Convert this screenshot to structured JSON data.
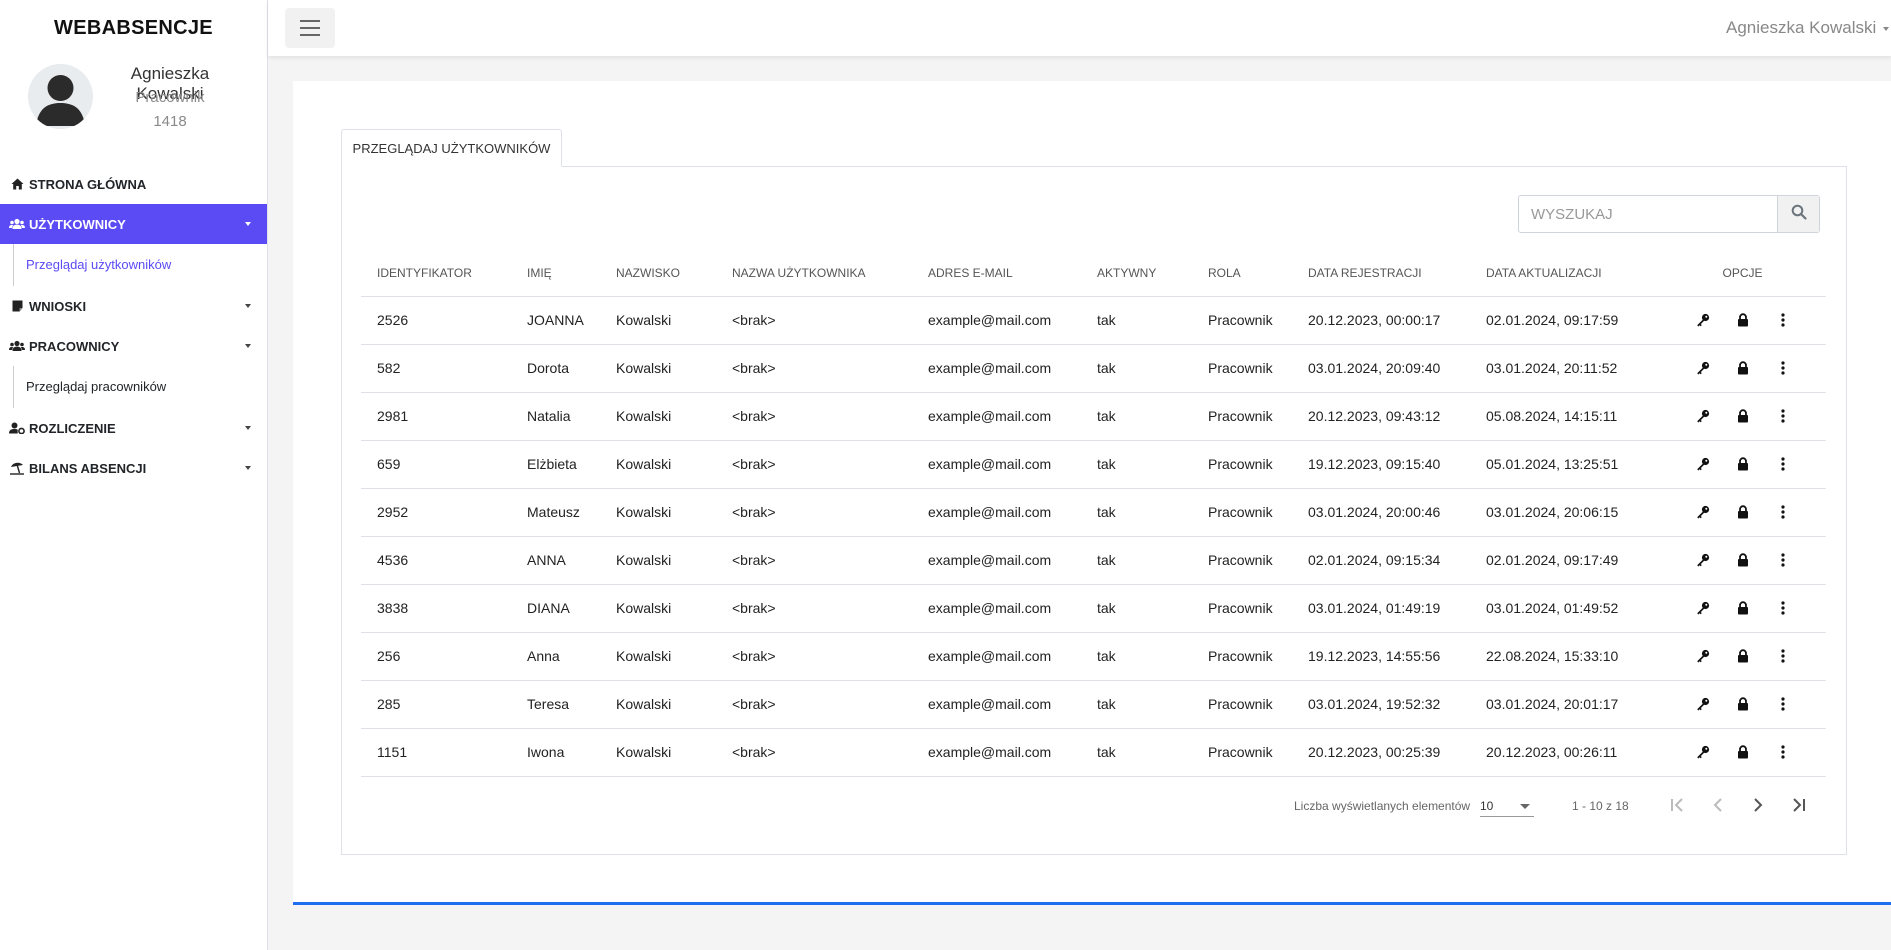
{
  "app": {
    "brand": "WEBABSENCJE"
  },
  "profile": {
    "name": "Agnieszka Kowalski",
    "role": "Pracownik",
    "id": "1418",
    "avatar_icon": "user-silhouette-icon"
  },
  "sidebar": {
    "items": [
      {
        "label": "STRONA GŁÓWNA",
        "icon": "home-icon"
      },
      {
        "label": "UŻYTKOWNICY",
        "icon": "users-icon",
        "active": true,
        "sub": "Przeglądaj użytkowników"
      },
      {
        "label": "WNIOSKI",
        "icon": "note-icon"
      },
      {
        "label": "PRACOWNICY",
        "icon": "users-icon",
        "sub": "Przeglądaj pracowników"
      },
      {
        "label": "ROZLICZENIE",
        "icon": "user-cog-icon"
      },
      {
        "label": "BILANS ABSENCJI",
        "icon": "umbrella-beach-icon"
      }
    ]
  },
  "topbar": {
    "user": "Agnieszka Kowalski",
    "menu_icon": "hamburger-icon"
  },
  "tab": {
    "label": "PRZEGLĄDAJ UŻYTKOWNIKÓW"
  },
  "search": {
    "placeholder": "WYSZUKAJ",
    "icon": "search-icon"
  },
  "table": {
    "headers": [
      "IDENTYFIKATOR",
      "IMIĘ",
      "NAZWISKO",
      "NAZWA UŻYTKOWNIKA",
      "ADRES E-MAIL",
      "AKTYWNY",
      "ROLA",
      "DATA REJESTRACJI",
      "DATA AKTUALIZACJI",
      "OPCJE"
    ],
    "rows": [
      [
        "2526",
        "JOANNA",
        "Kowalski",
        "<brak>",
        "example@mail.com",
        "tak",
        "Pracownik",
        "20.12.2023, 00:00:17",
        "02.01.2024, 09:17:59"
      ],
      [
        "582",
        "Dorota",
        "Kowalski",
        "<brak>",
        "example@mail.com",
        "tak",
        "Pracownik",
        "03.01.2024, 20:09:40",
        "03.01.2024, 20:11:52"
      ],
      [
        "2981",
        "Natalia",
        "Kowalski",
        "<brak>",
        "example@mail.com",
        "tak",
        "Pracownik",
        "20.12.2023, 09:43:12",
        "05.08.2024, 14:15:11"
      ],
      [
        "659",
        "Elżbieta",
        "Kowalski",
        "<brak>",
        "example@mail.com",
        "tak",
        "Pracownik",
        "19.12.2023, 09:15:40",
        "05.01.2024, 13:25:51"
      ],
      [
        "2952",
        "Mateusz",
        "Kowalski",
        "<brak>",
        "example@mail.com",
        "tak",
        "Pracownik",
        "03.01.2024, 20:00:46",
        "03.01.2024, 20:06:15"
      ],
      [
        "4536",
        "ANNA",
        "Kowalski",
        "<brak>",
        "example@mail.com",
        "tak",
        "Pracownik",
        "02.01.2024, 09:15:34",
        "02.01.2024, 09:17:49"
      ],
      [
        "3838",
        "DIANA",
        "Kowalski",
        "<brak>",
        "example@mail.com",
        "tak",
        "Pracownik",
        "03.01.2024, 01:49:19",
        "03.01.2024, 01:49:52"
      ],
      [
        "256",
        "Anna",
        "Kowalski",
        "<brak>",
        "example@mail.com",
        "tak",
        "Pracownik",
        "19.12.2023, 14:55:56",
        "22.08.2024, 15:33:10"
      ],
      [
        "285",
        "Teresa",
        "Kowalski",
        "<brak>",
        "example@mail.com",
        "tak",
        "Pracownik",
        "03.01.2024, 19:52:32",
        "03.01.2024, 20:01:17"
      ],
      [
        "1151",
        "Iwona",
        "Kowalski",
        "<brak>",
        "example@mail.com",
        "tak",
        "Pracownik",
        "20.12.2023, 00:25:39",
        "20.12.2023, 00:26:11"
      ]
    ],
    "row_option_icons": [
      "key-icon",
      "lock-icon",
      "more-vertical-icon"
    ]
  },
  "paginator": {
    "label": "Liczba wyświetlanych elementów",
    "page_size": "10",
    "range": "1 - 10 z 18",
    "icons": [
      "first-page-icon",
      "prev-page-icon",
      "next-page-icon",
      "last-page-icon"
    ]
  },
  "colors": {
    "accent": "#5b4bf5",
    "bottom_line": "#1e6ff0"
  }
}
